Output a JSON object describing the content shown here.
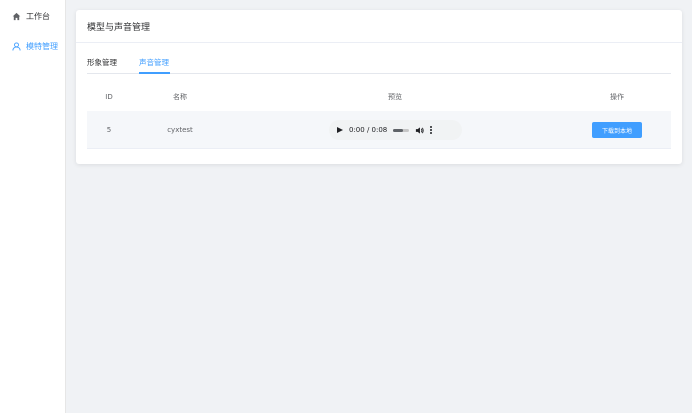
{
  "sidebar": {
    "items": [
      {
        "label": "工作台",
        "icon": "home-icon",
        "active": false
      },
      {
        "label": "模特管理",
        "icon": "user-icon",
        "active": true
      }
    ]
  },
  "card": {
    "title": "模型与声音管理"
  },
  "tabs": [
    {
      "label": "形象管理",
      "active": false
    },
    {
      "label": "声音管理",
      "active": true
    }
  ],
  "table": {
    "columns": [
      "ID",
      "名称",
      "预览",
      "操作"
    ],
    "rows": [
      {
        "id": "5",
        "name": "cyxtest",
        "audio": {
          "time": "0:00 / 0:08",
          "volume_fraction": 0.6
        },
        "action_label": "下载到本地"
      }
    ]
  },
  "colors": {
    "accent": "#409eff",
    "page_background": "#f0f2f5",
    "row_background": "#f5f7fa"
  }
}
